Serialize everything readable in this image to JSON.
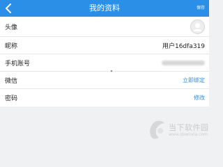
{
  "header": {
    "title": "我的资料",
    "save_label": "保存",
    "back_icon": "chevron-left-icon",
    "background": "#2c8fe7"
  },
  "rows": [
    {
      "label": "头像",
      "icon": "avatar-placeholder-icon"
    },
    {
      "label": "昵称",
      "value": "用户16dfa319"
    },
    {
      "label": "手机账号",
      "value": ""
    },
    {
      "label": "微信",
      "action": "立即绑定"
    },
    {
      "label": "密码",
      "action": "修改"
    }
  ],
  "watermark": {
    "name": "当下软件园",
    "url": "www.downxia.com"
  },
  "colors": {
    "accent": "#2c8fe7",
    "page_bg": "#f0f1f3",
    "card_bg": "#ffffff"
  }
}
